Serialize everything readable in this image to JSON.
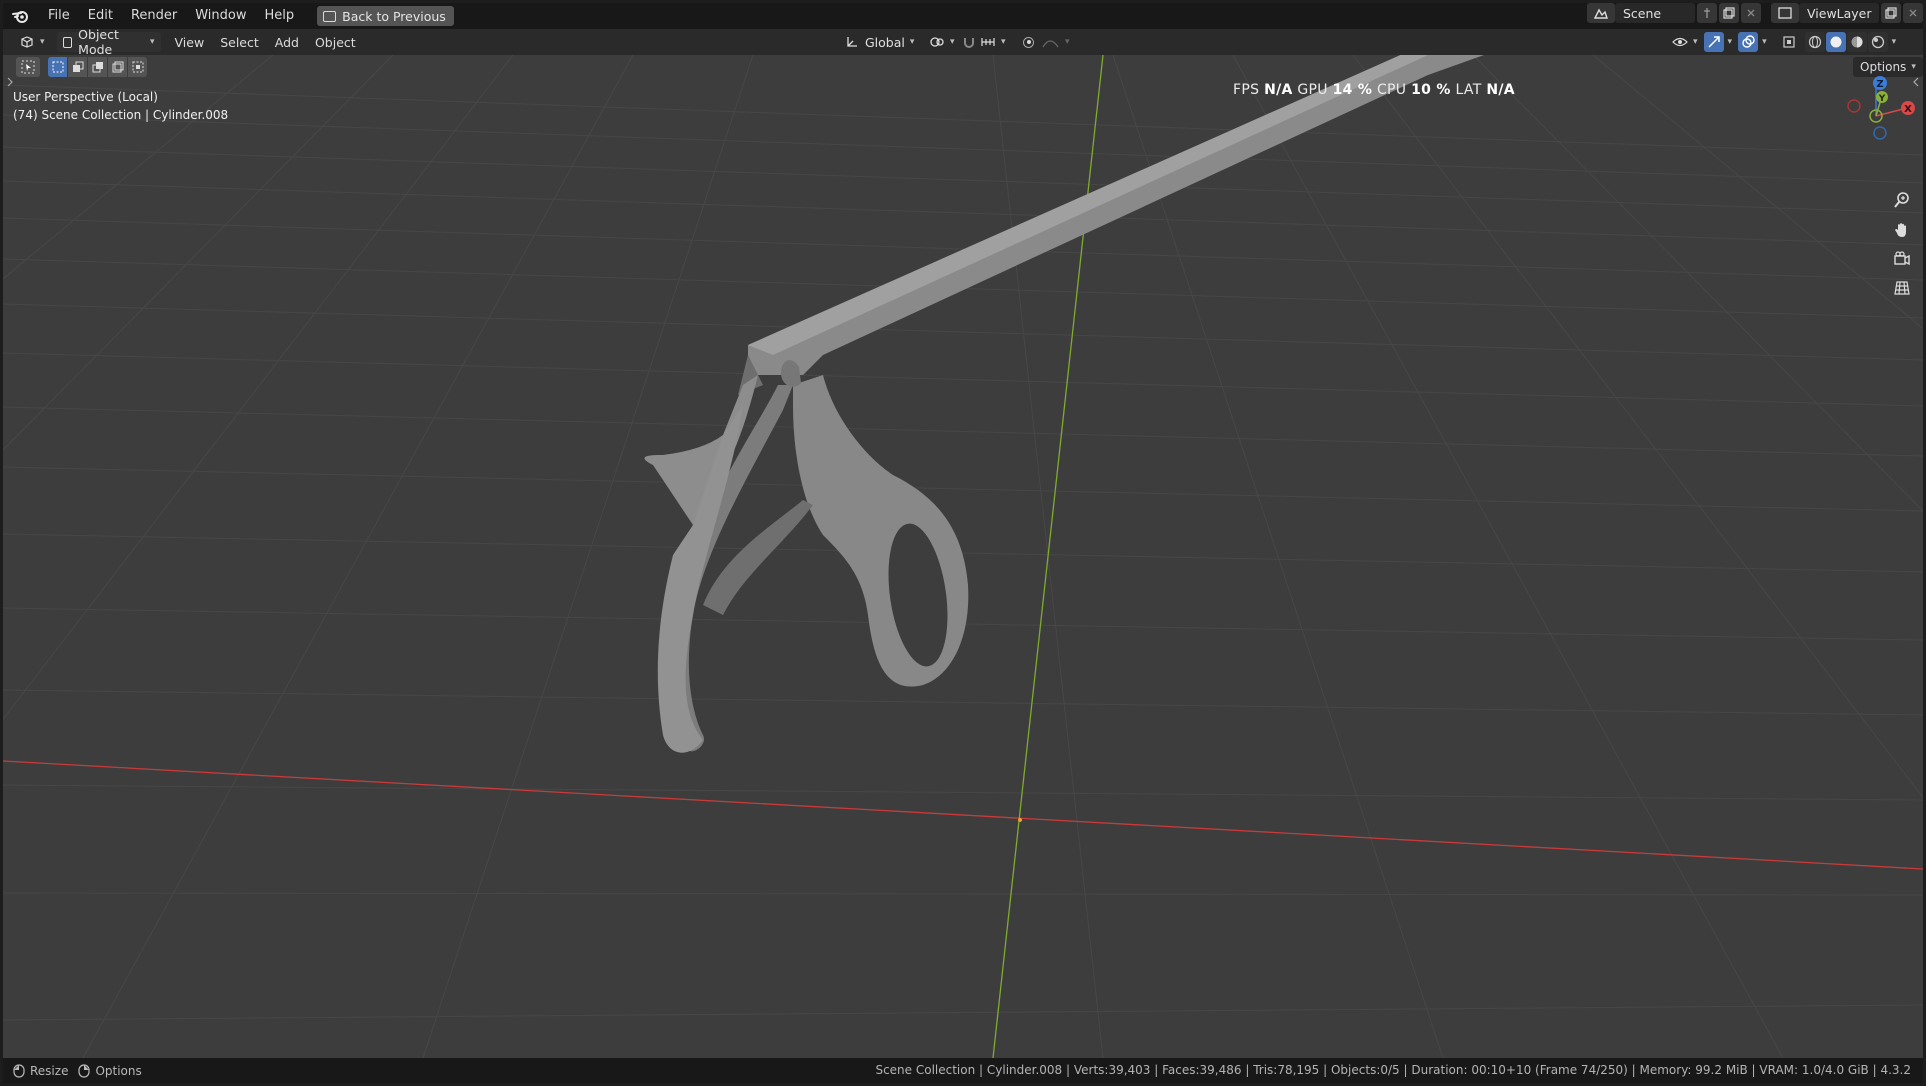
{
  "topbar": {
    "menus": [
      "File",
      "Edit",
      "Render",
      "Window",
      "Help"
    ],
    "back_button": "Back to Previous",
    "scene_name": "Scene",
    "view_layer": "ViewLayer"
  },
  "header": {
    "mode": "Object Mode",
    "menus": [
      "View",
      "Select",
      "Add",
      "Object"
    ],
    "orientation": "Global"
  },
  "overlay": {
    "perspective": "User Perspective (Local)",
    "collection": "(74) Scene Collection | Cylinder.008",
    "fps_label": "FPS",
    "fps_value": "N/A",
    "gpu_label": "GPU",
    "gpu_value": "14 %",
    "cpu_label": "CPU",
    "cpu_value": "10 %",
    "lat_label": "LAT",
    "lat_value": "N/A",
    "options": "Options",
    "gizmo_axes": {
      "z": "Z",
      "y": "Y",
      "x": "X"
    }
  },
  "statusbar": {
    "resize": "Resize",
    "options": "Options",
    "info": "Scene Collection | Cylinder.008 | Verts:39,403 | Faces:39,486 | Tris:78,195 | Objects:0/5 | Duration: 00:10+10 (Frame 74/250) | Memory: 99.2 MiB | VRAM: 1.0/4.0 GiB | 4.3.2"
  },
  "colors": {
    "x_axis": "#c83b3b",
    "y_axis": "#7fab2f",
    "active_blue": "#4772b3",
    "model_gray": "#8a8a8a"
  }
}
